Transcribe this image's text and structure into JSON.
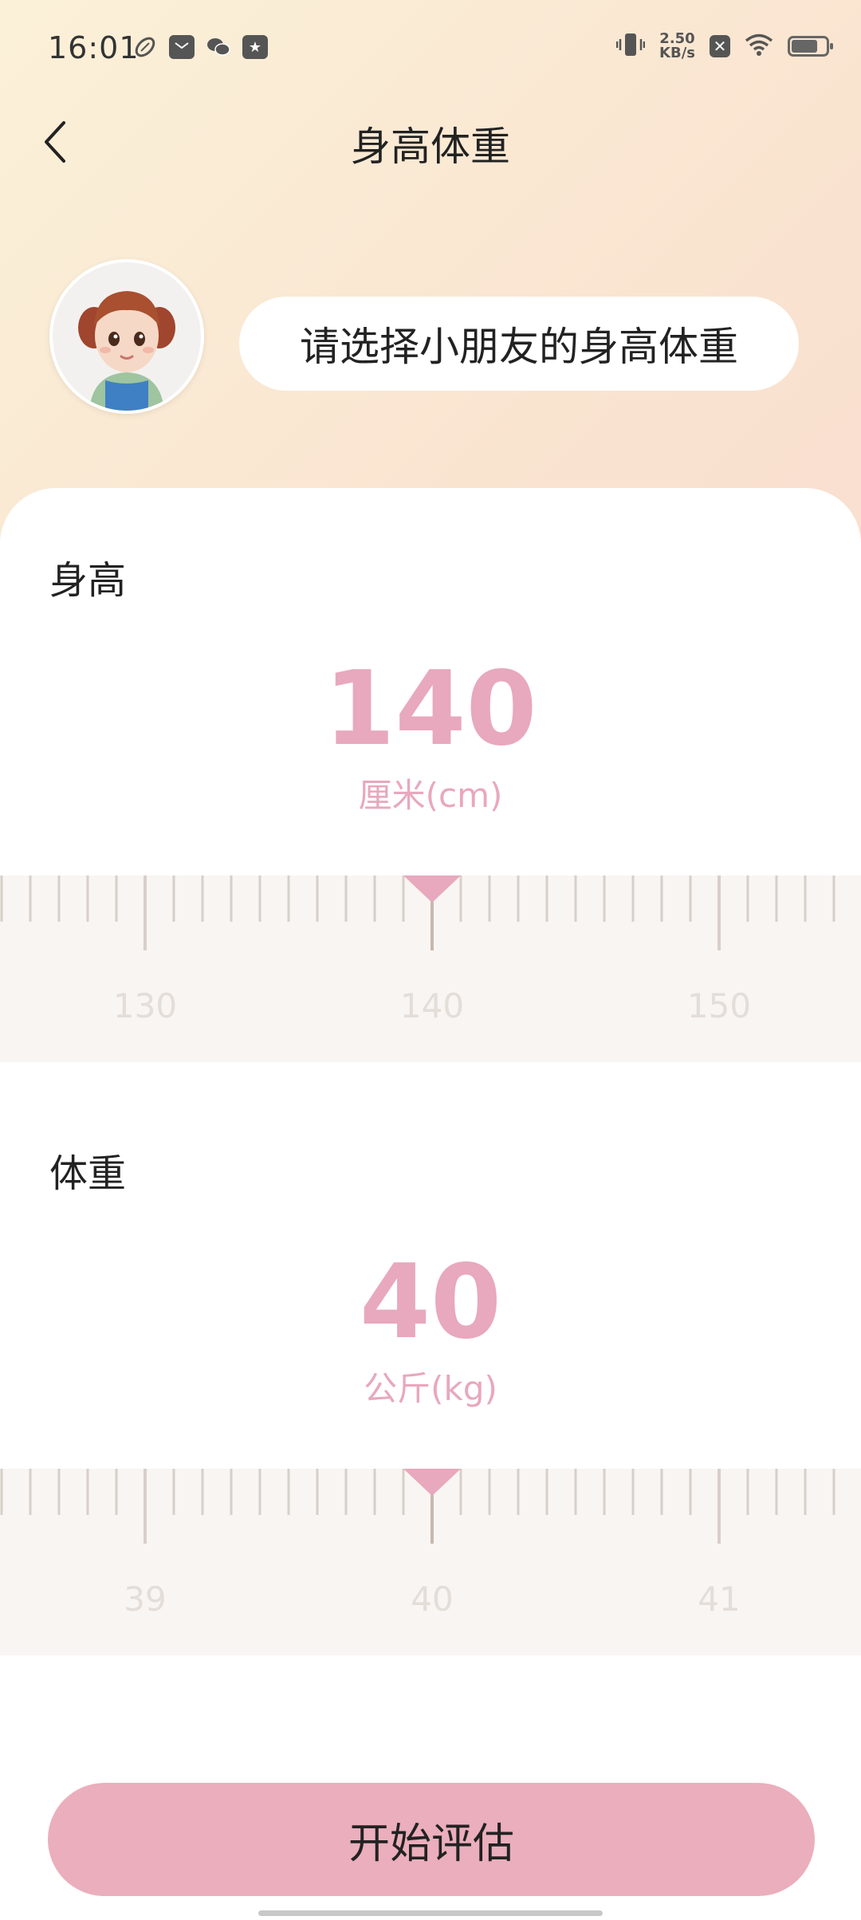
{
  "status_bar": {
    "time": "16:01",
    "net_speed_value": "2.50",
    "net_speed_unit": "KB/s",
    "icons": [
      "rugby-icon",
      "mail-icon",
      "wechat-icon",
      "star-icon",
      "vibrate-icon",
      "sim-x-icon",
      "wifi-icon",
      "battery-icon"
    ],
    "battery_level": 0.7
  },
  "header": {
    "title": "身高体重"
  },
  "prompt": {
    "text": "请选择小朋友的身高体重"
  },
  "height": {
    "label": "身高",
    "value": "140",
    "unit": "厘米(cm)",
    "ticks": [
      "130",
      "140",
      "150"
    ]
  },
  "weight": {
    "label": "体重",
    "value": "40",
    "unit": "公斤(kg)",
    "ticks": [
      "39",
      "40",
      "41"
    ]
  },
  "actions": {
    "start_label": "开始评估"
  },
  "colors": {
    "accent": "#e8a8bd",
    "button": "#ebaebc",
    "ruler_bg": "#f8f5f3",
    "tick": "#d8cfc8"
  }
}
